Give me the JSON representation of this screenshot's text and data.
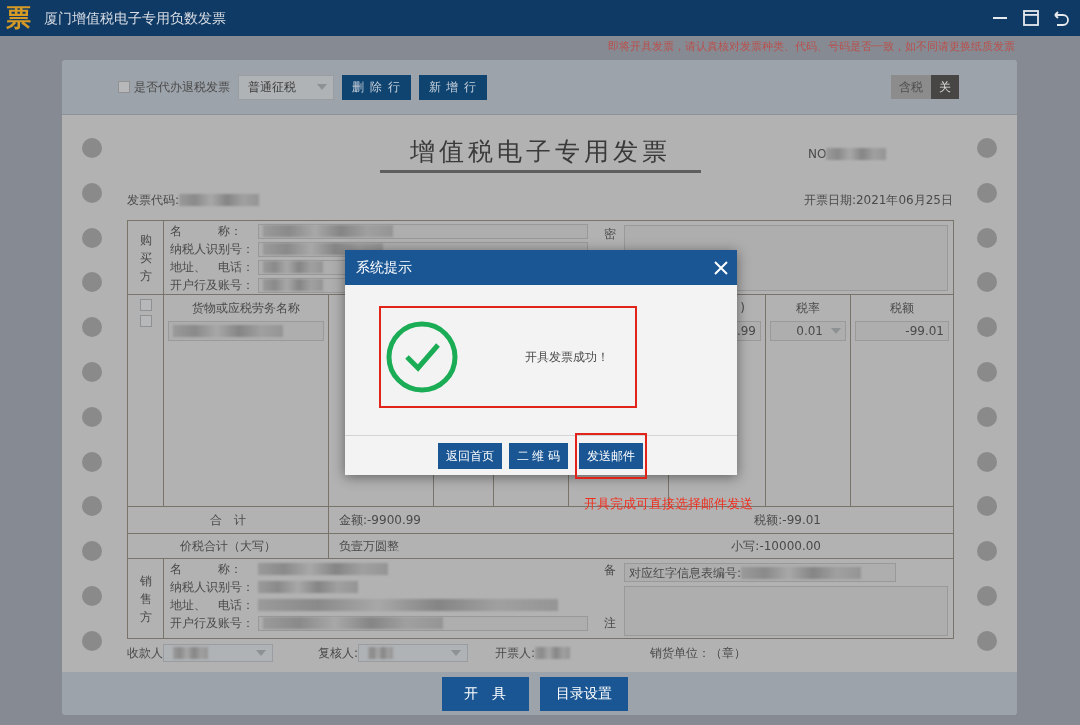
{
  "window": {
    "logo": "票",
    "title": "厦门增值税电子专用负数发票"
  },
  "notice": "即将开具发票，请认真核对发票种类、代码、号码是否一致，如不同请更换纸质发票",
  "toolbar": {
    "refund_checkbox": {
      "label": "是否代办退税发票",
      "checked": false
    },
    "tax_type": "普通征税",
    "buttons": [
      "删 除 行",
      "新 增 行"
    ],
    "tax_toggle": [
      {
        "label": "含税",
        "selected": false
      },
      {
        "label": "关",
        "selected": true
      }
    ]
  },
  "invoice": {
    "title": "增值税电子专用发票",
    "number_label": "NO",
    "code_label": "发票代码:",
    "date": "开票日期:2021年06月25日",
    "buyer": {
      "side_label": "购买方",
      "field_labels": [
        "名　　　称：",
        "纳税人识别号：",
        "地址、　电话：",
        "开户行及账号："
      ],
      "cipher_label": "密"
    },
    "item_columns": {
      "name": "货物或应税劳务名称",
      "column_7": ")",
      "rate": "税率",
      "tax": "税额"
    },
    "item_checkboxes": [
      {
        "checked": false
      },
      {
        "checked": false
      }
    ],
    "item_row": {
      "column_7": ".99",
      "rate": "0.01",
      "tax": "-99.01"
    },
    "total": {
      "label": "合　计",
      "amount": "金额:-9900.99",
      "tax": "税额:-99.01"
    },
    "total_in_words": {
      "label": "价税合计（大写）",
      "words": "负壹万圆整",
      "figure": "小写:-10000.00"
    },
    "seller": {
      "side_label": "销售方",
      "field_labels": [
        "名　　　称：",
        "纳税人识别号：",
        "地址、　电话：",
        "开户行及账号："
      ],
      "remark_labels": [
        "备",
        "注"
      ],
      "remark_value": "对应红字信息表编号:"
    },
    "footer": {
      "payee": "收款人",
      "reviewer": "复核人:",
      "drawer": "开票人:",
      "seal": "销货单位：（章）"
    }
  },
  "bottom_buttons": [
    "开　具",
    "目录设置"
  ],
  "dialog": {
    "title": "系统提示",
    "message": "开具发票成功！",
    "message_highlighted": true,
    "buttons": [
      {
        "label": "返回首页",
        "highlighted": false
      },
      {
        "label": "二 维 码",
        "highlighted": false
      },
      {
        "label": "发送邮件",
        "highlighted": true
      }
    ],
    "annotation": "开具完成可直接选择邮件发送"
  }
}
